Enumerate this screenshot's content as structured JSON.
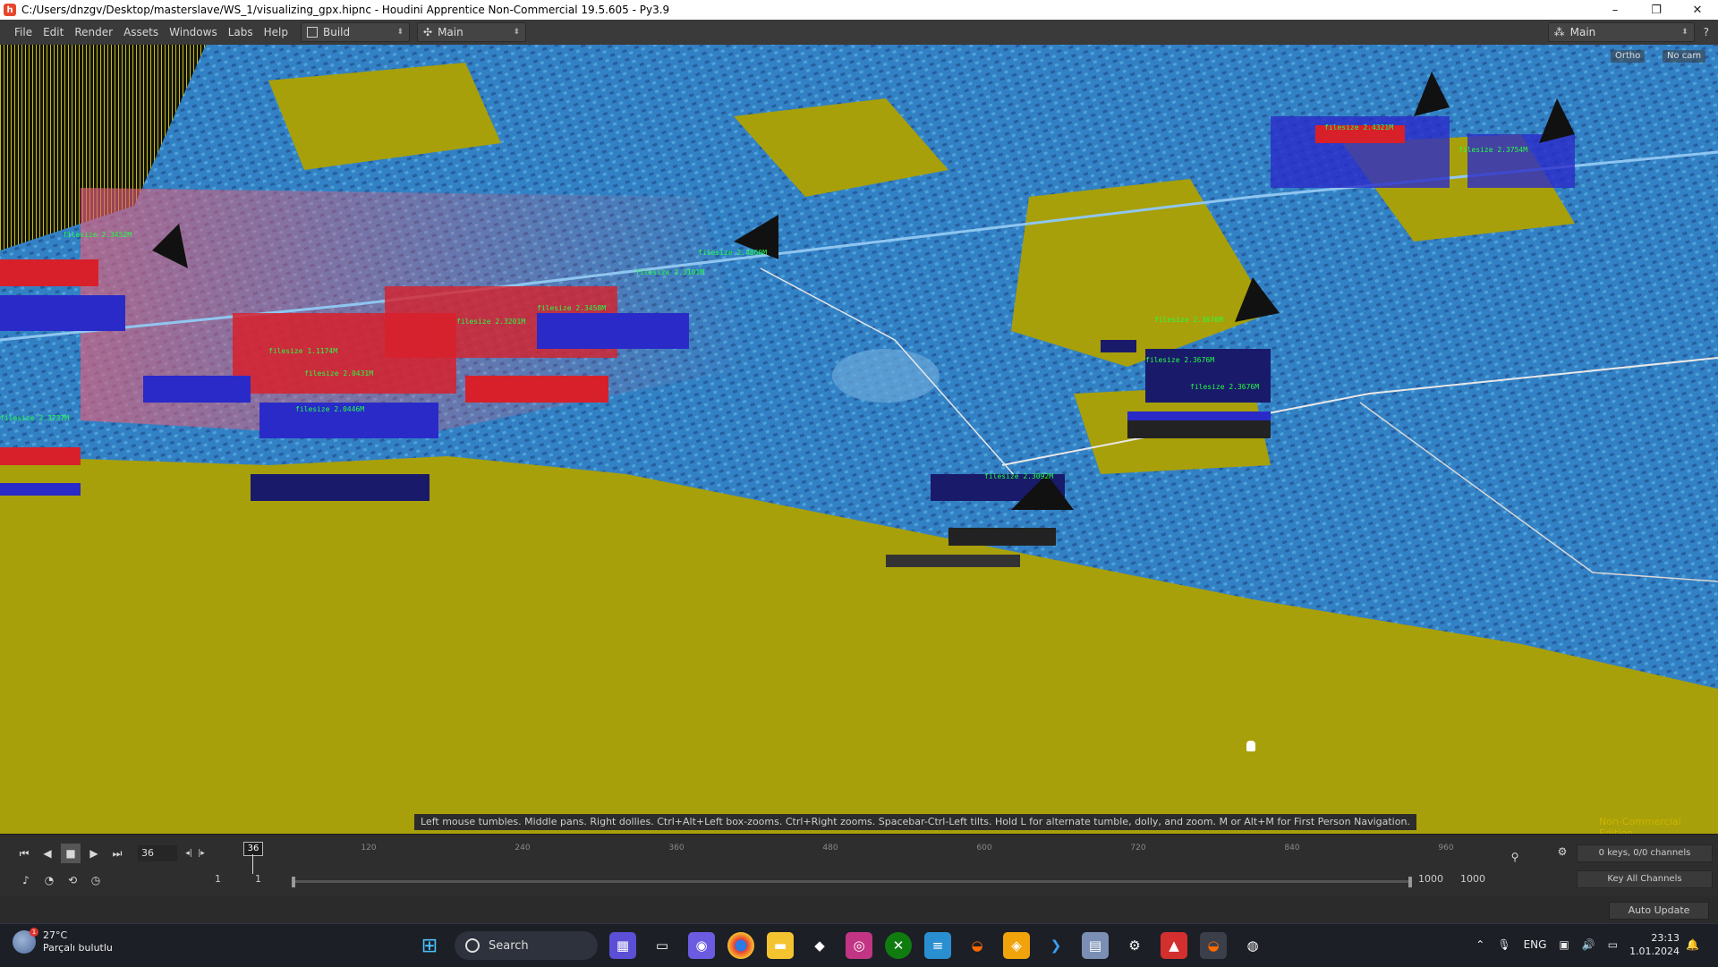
{
  "window": {
    "title": "C:/Users/dnzgv/Desktop/masterslave/WS_1/visualizing_gpx.hipnc - Houdini Apprentice Non-Commercial 19.5.605 - Py3.9",
    "app_icon": "houdini-logo-icon",
    "minimize": "–",
    "maximize": "❐",
    "close": "✕"
  },
  "menu": {
    "items": [
      "File",
      "Edit",
      "Render",
      "Assets",
      "Windows",
      "Labs",
      "Help"
    ],
    "desktop_selector": "Build",
    "network_selector": "Main",
    "right_selector": "Main"
  },
  "viewport": {
    "ortho_button": "Ortho",
    "camera_button": "No cam",
    "hint": "Left mouse tumbles. Middle pans. Right dollies. Ctrl+Alt+Left box-zooms. Ctrl+Right zooms. Spacebar-Ctrl-Left tilts. Hold L for alternate tumble, dolly, and zoom.    M or Alt+M for First Person Navigation.",
    "watermark": "Non-Commercial Edition",
    "colors": {
      "ground": "#a8a00a",
      "buildings": "#2b7fd0",
      "points_red": "#d8202a",
      "points_blue": "#2a2ac8",
      "labels": "#22ff44"
    }
  },
  "timeline": {
    "current_frame": "36",
    "playhead_label": "36",
    "ruler_labels": [
      "120",
      "240",
      "360",
      "480",
      "600",
      "720",
      "840",
      "960"
    ],
    "range_start": "1",
    "range_start_2": "1",
    "range_end": "1000",
    "range_end_2": "1000",
    "keys_info": "0 keys, 0/0 channels",
    "key_all": "Key All Channels"
  },
  "statusbar": {
    "auto_update": "Auto Update"
  },
  "taskbar": {
    "temperature": "27°C",
    "weather": "Parçalı bulutlu",
    "weather_badge": "1",
    "search": "Search",
    "language": "ENG",
    "time": "23:13",
    "date": "1.01.2024"
  }
}
